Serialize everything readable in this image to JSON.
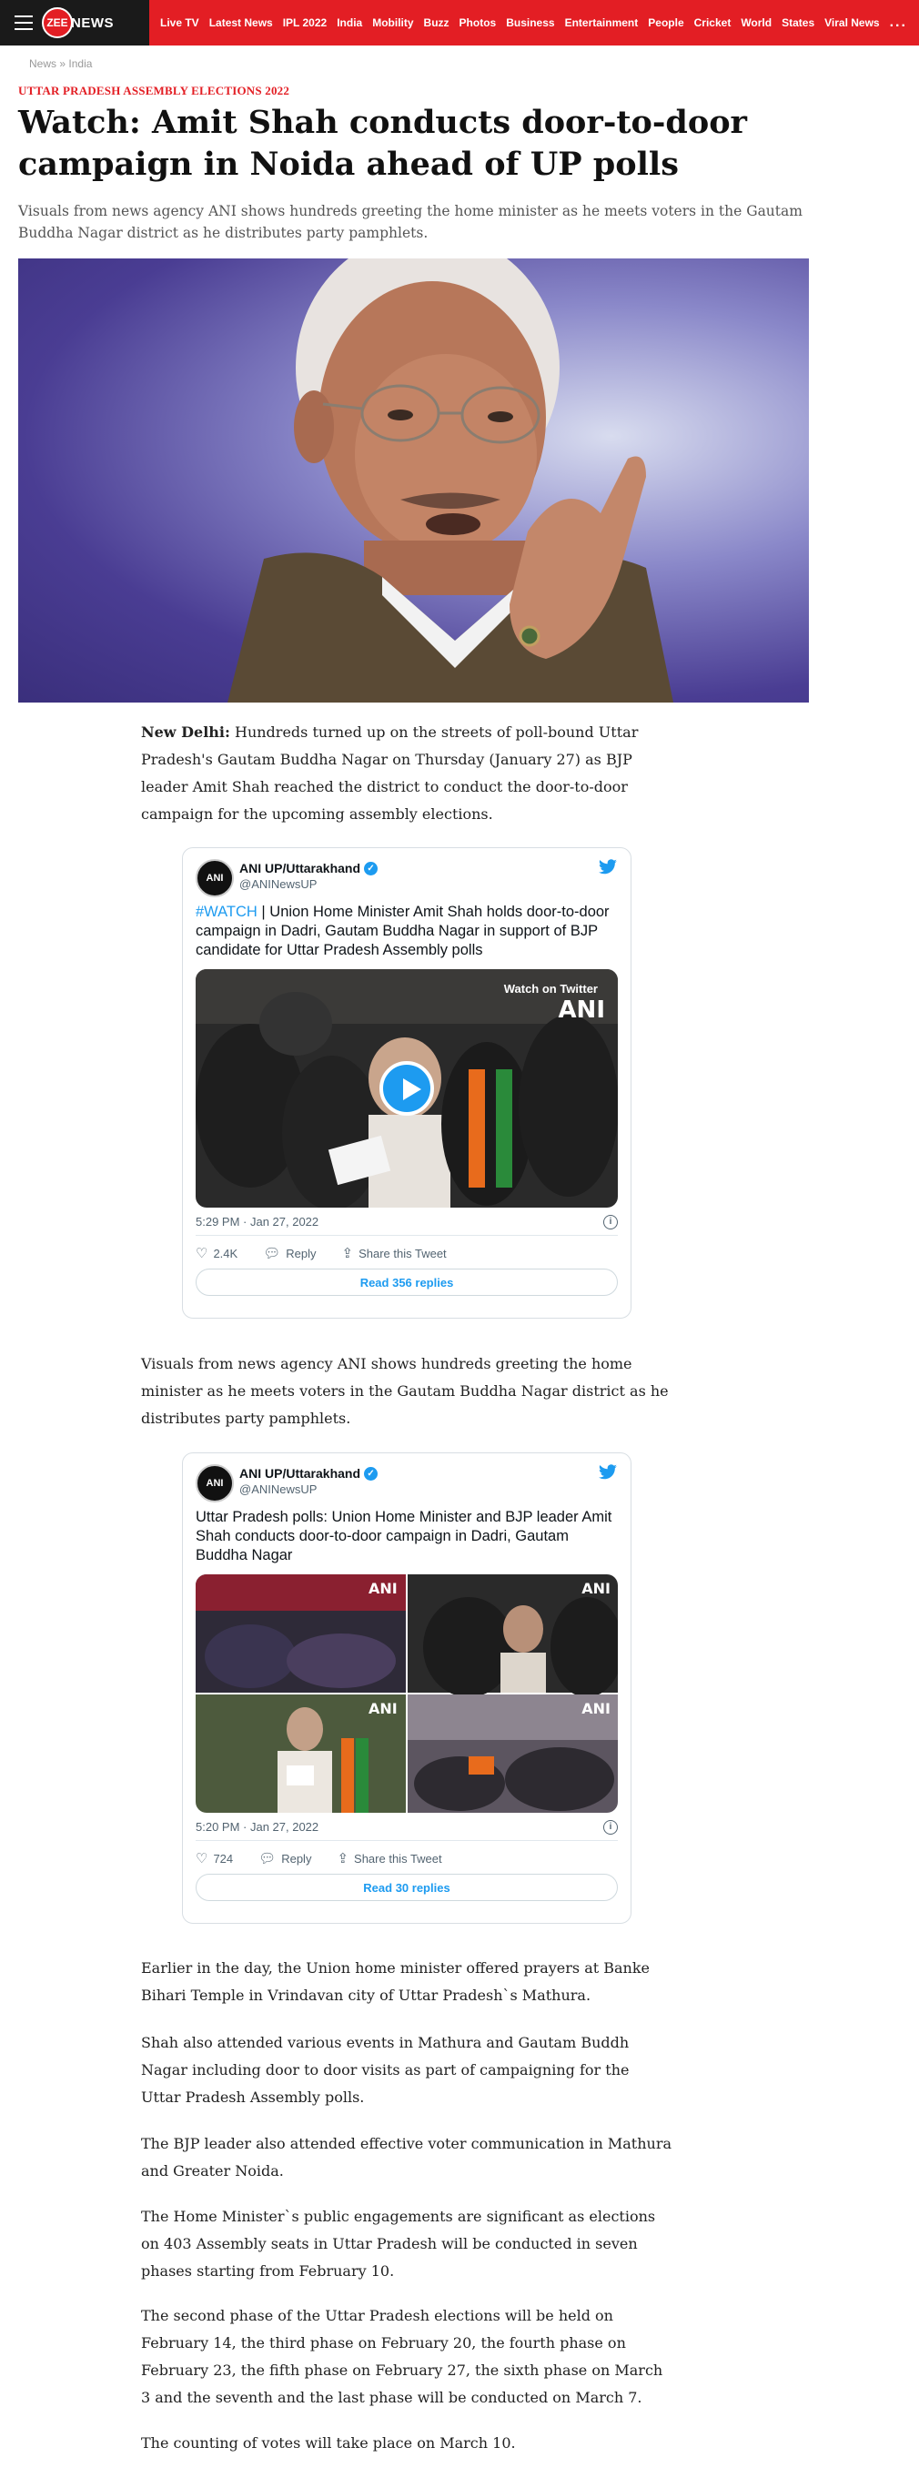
{
  "nav": {
    "logo_mark": "ZEE",
    "logo_text": "NEWS",
    "items": [
      "Live TV",
      "Latest News",
      "IPL 2022",
      "India",
      "Mobility",
      "Buzz",
      "Photos",
      "Business",
      "Entertainment",
      "People",
      "Cricket",
      "World",
      "States",
      "Viral News"
    ],
    "more": "..."
  },
  "breadcrumb": {
    "home": "News",
    "separator": "»",
    "section": "India"
  },
  "article": {
    "category": "UTTAR PRADESH ASSEMBLY ELECTIONS 2022",
    "headline": "Watch: Amit Shah conducts door-to-door campaign in Noida ahead of UP polls",
    "summary": "Visuals from news agency ANI shows hundreds greeting the home minister as he meets voters in the Gautam Buddha Nagar district as he distributes party pamphlets.",
    "dateline": "New Delhi:",
    "para1": " Hundreds turned up on the streets of poll-bound Uttar Pradesh's Gautam Buddha Nagar on Thursday (January 27) as BJP leader Amit Shah reached the district to conduct the door-to-door campaign for the upcoming assembly elections.",
    "para2": "Visuals from news agency ANI shows hundreds greeting the home minister as he meets voters in the Gautam Buddha Nagar district as he distributes party pamphlets.",
    "para3": "Earlier in the day, the Union home minister offered prayers at Banke Bihari Temple in Vrindavan city of Uttar Pradesh`s Mathura.",
    "para4": "Shah also attended various events in Mathura and Gautam Buddh Nagar including door to door visits as part of campaigning for the Uttar Pradesh Assembly polls.",
    "para5": "The BJP leader also attended effective voter communication in Mathura and Greater Noida.",
    "para6": "The Home Minister`s public engagements are significant as elections on 403 Assembly seats in Uttar Pradesh will be conducted in seven phases starting from February 10.",
    "para7": "The second phase of the Uttar Pradesh elections will be held on February 14, the third phase on February 20, the fourth phase on February 23, the fifth phase on February 27, the sixth phase on March 3 and the seventh and the last phase will be conducted on March 7.",
    "para8": "The counting of votes will take place on March 10."
  },
  "tweet1": {
    "avatar": "ANI",
    "name": "ANI UP/Uttarakhand",
    "handle": "@ANINewsUP",
    "hashtag": "#WATCH",
    "text": " | Union Home Minister Amit Shah holds door-to-door campaign in Dadri, Gautam Buddha Nagar in support of BJP candidate for Uttar Pradesh Assembly polls",
    "watch_label": "Watch on Twitter",
    "watermark": "ANI",
    "time": "5:29 PM · Jan 27, 2022",
    "likes": "2.4K",
    "reply_label": "Reply",
    "share_label": "Share this Tweet",
    "read_replies": "Read 356 replies"
  },
  "tweet2": {
    "avatar": "ANI",
    "name": "ANI UP/Uttarakhand",
    "handle": "@ANINewsUP",
    "text": "Uttar Pradesh polls: Union Home Minister and BJP leader Amit Shah conducts door-to-door campaign in Dadri, Gautam Buddha Nagar",
    "watermark": "ANI",
    "time": "5:20 PM · Jan 27, 2022",
    "likes": "724",
    "reply_label": "Reply",
    "share_label": "Share this Tweet",
    "read_replies": "Read 30 replies"
  },
  "icons": {
    "menu": "hamburger-icon",
    "verified": "verified-badge-icon",
    "twitter": "twitter-bird-icon",
    "heart": "heart-icon",
    "reply": "reply-icon",
    "share": "share-icon",
    "info": "info-icon",
    "play": "play-icon"
  },
  "colors": {
    "brand_red": "#e31e24",
    "twitter_blue": "#1d9bf0",
    "nav_dark": "#1a1a1a"
  }
}
